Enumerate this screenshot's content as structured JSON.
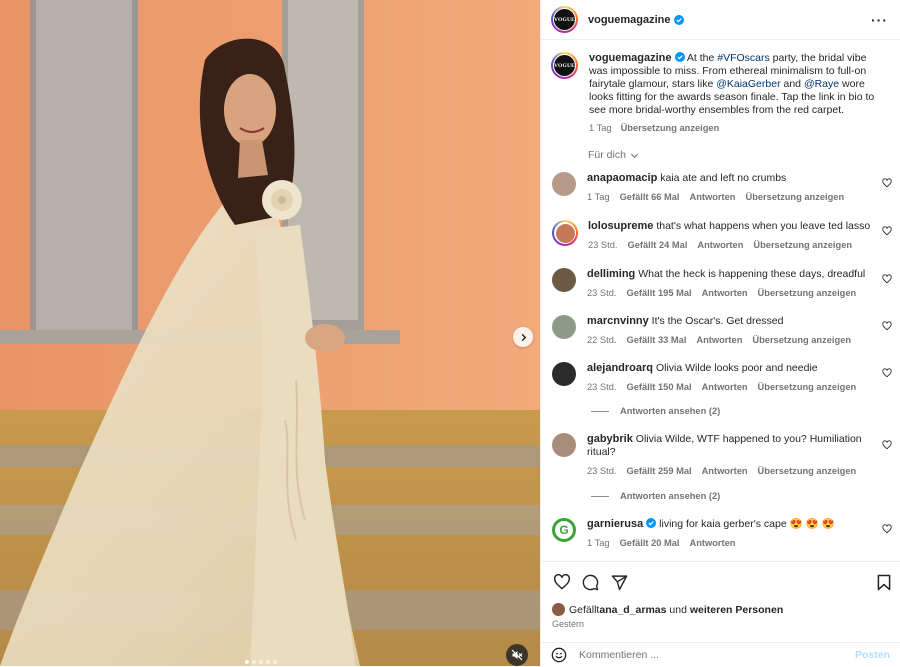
{
  "header": {
    "username": "voguemagazine",
    "logo_text": "VOGUE"
  },
  "caption": {
    "username": "voguemagazine",
    "text_1": " At the ",
    "hashtag": "#VFOscars",
    "text_2": " party, the bridal vibe was impossible to miss. From ethereal minimalism to full-on fairytale glamour, stars like ",
    "mention_1": "@KaiaGerber",
    "text_3": " and ",
    "mention_2": "@Raye",
    "text_4": " wore looks fitting for the awards season finale. Tap the link in bio to see more bridal-worthy ensembles from the red carpet.",
    "time": "1 Tag",
    "translate": "Übersetzung anzeigen"
  },
  "sort_label": "Für dich",
  "comments": [
    {
      "username": "anapaomacip",
      "text": "kaia ate and left no crumbs",
      "time": "1 Tag",
      "likes": "Gefällt 66 Mal",
      "reply": "Antworten",
      "translate": "Übersetzung anzeigen"
    },
    {
      "username": "lolosupreme",
      "text": "that's what happens when you leave ted lasso",
      "time": "23 Std.",
      "likes": "Gefällt 24 Mal",
      "reply": "Antworten",
      "translate": "Übersetzung anzeigen"
    },
    {
      "username": "delliming",
      "text": "What the heck is happening these days, dreadful",
      "time": "23 Std.",
      "likes": "Gefällt 195 Mal",
      "reply": "Antworten",
      "translate": "Übersetzung anzeigen"
    },
    {
      "username": "marcnvinny",
      "text": "It's the Oscar's. Get dressed",
      "time": "22 Std.",
      "likes": "Gefällt 33 Mal",
      "reply": "Antworten",
      "translate": "Übersetzung anzeigen"
    },
    {
      "username": "alejandroarq",
      "text": "Olivia Wilde looks poor and needie",
      "time": "23 Std.",
      "likes": "Gefällt 150 Mal",
      "reply": "Antworten",
      "translate": "Übersetzung anzeigen",
      "view_replies": "Antworten ansehen (2)"
    },
    {
      "username": "gabybrik",
      "text": "Olivia Wilde, WTF happened to you? Humiliation ritual?",
      "time": "23 Std.",
      "likes": "Gefällt 259 Mal",
      "reply": "Antworten",
      "translate": "Übersetzung anzeigen",
      "view_replies": "Antworten ansehen (2)"
    },
    {
      "username": "garnierusa",
      "text": "living for kaia gerber's cape 😍 😍 😍",
      "time": "1 Tag",
      "likes": "Gefällt 20 Mal",
      "reply": "Antworten",
      "avatar_letter": "G"
    }
  ],
  "likes_line": {
    "prefix": "Gefällt ",
    "user": "ana_d_armas",
    "middle": " und ",
    "others": "weiteren Personen"
  },
  "post_date": "Gestern",
  "composer": {
    "placeholder": "Kommentieren ...",
    "post_label": "Posten"
  },
  "colors": {
    "accent": "#0095f6",
    "link": "#00376b",
    "muted": "#737373",
    "background_orange": "#e9a272"
  },
  "icons": [
    "more-icon",
    "verified-icon",
    "heart-icon",
    "comment-icon",
    "share-icon",
    "bookmark-icon",
    "emoji-icon",
    "chevron-right-icon",
    "mute-icon",
    "chevron-down-icon"
  ]
}
